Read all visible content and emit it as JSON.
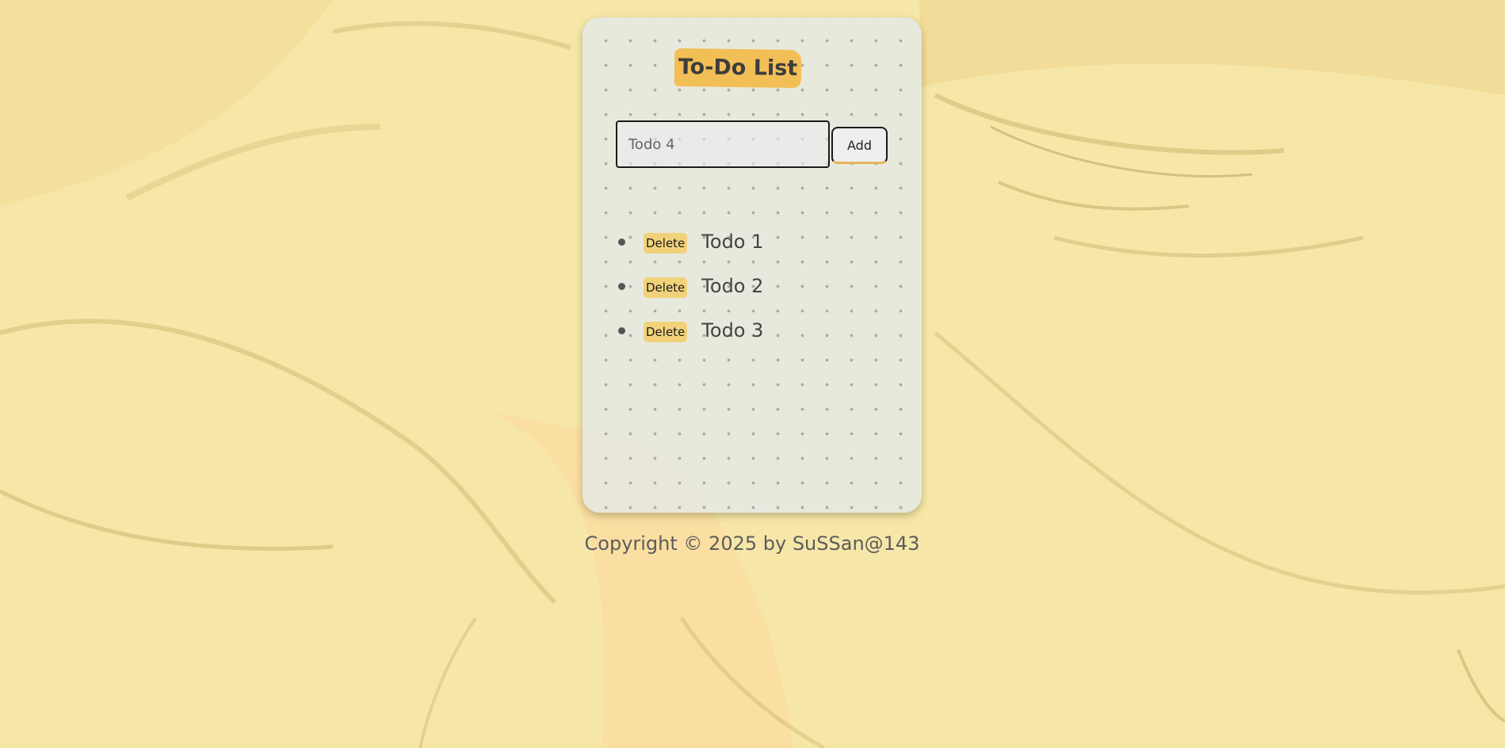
{
  "app": {
    "title": "To-Do List"
  },
  "input": {
    "value": "Todo 4",
    "placeholder": ""
  },
  "add_button": {
    "label": "Add"
  },
  "todos": [
    {
      "delete_label": "Delete",
      "text": "Todo 1"
    },
    {
      "delete_label": "Delete",
      "text": "Todo 2"
    },
    {
      "delete_label": "Delete",
      "text": "Todo 3"
    }
  ],
  "footer": {
    "text": "Copyright © 2025 by SuSSan@143"
  },
  "colors": {
    "background": "#f6e7a8",
    "title_highlight": "#f2bf56",
    "delete_button": "#f1d27b",
    "card": "#e4e9ec"
  }
}
